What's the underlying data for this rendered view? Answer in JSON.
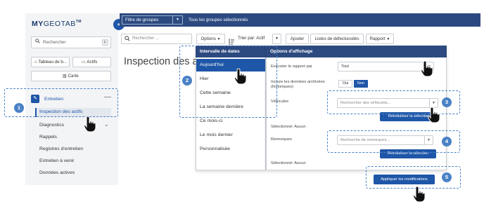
{
  "app": {
    "logo_brand": "MY",
    "logo_name": "GEOTAB",
    "logo_tm": "TM"
  },
  "sidebar": {
    "search_placeholder": "Rechercher",
    "search_shortcut": "F",
    "dashboard_button": "Tableau de b...",
    "assets_button": "Actifs",
    "map_button": "Carte",
    "section_label": "Entretien",
    "section_collapse": "—",
    "items": [
      {
        "label": "Inspection des actifs"
      },
      {
        "label": "Diagnostics"
      },
      {
        "label": "Rappels"
      },
      {
        "label": "Registres d'entretien"
      },
      {
        "label": "Entretien à venir"
      },
      {
        "label": "Données actives"
      }
    ]
  },
  "topbar": {
    "group_filter_label": "Filtre de groupes",
    "group_status": "Tous les groupes sélectionnés"
  },
  "toolbar": {
    "search_placeholder": "Rechercher ...",
    "options_label": "Options",
    "sort_label": "Trier par: Actif",
    "add_label": "Ajouter",
    "defects_label": "Listes de défectuosités",
    "report_label": "Rapport"
  },
  "page": {
    "title": "Inspection des a"
  },
  "date_interval": {
    "header": "Intervalle de dates",
    "options": [
      {
        "label": "Aujourd'hui",
        "selected": true
      },
      {
        "label": "Hier",
        "selected": false
      },
      {
        "label": "Cette semaine",
        "selected": false
      },
      {
        "label": "La semaine dernière",
        "selected": false
      },
      {
        "label": "Ce mois-ci",
        "selected": false
      },
      {
        "label": "Le mois dernier",
        "selected": false
      },
      {
        "label": "Personnalisée",
        "selected": false
      }
    ]
  },
  "display_options": {
    "header": "Options d'affichage",
    "run_report_by_label": "Exécuter le rapport par",
    "run_report_by_value": "Tout",
    "include_archived_label": "Inclure les données archivées (historiques)",
    "toggle_no": "Oui",
    "toggle_yes": "Non",
    "vehicles_label": "Véhicules",
    "vehicles_placeholder": "Rechercher des véhicules...",
    "reset_selection_label": "Réinitialiser la sélection",
    "vehicles_selected": "Sélectionné: Aucun",
    "trailers_label": "Remorques",
    "trailers_placeholder": "Recherche de remorques...",
    "trailers_selected": "Sélectionné: Aucun",
    "apply_label": "Appliquer les modifications"
  },
  "callouts": [
    "1",
    "2",
    "3",
    "4",
    "5"
  ],
  "colors": {
    "primary": "#1e56a8",
    "header": "#2c4a80",
    "callout": "#4a82c5"
  }
}
